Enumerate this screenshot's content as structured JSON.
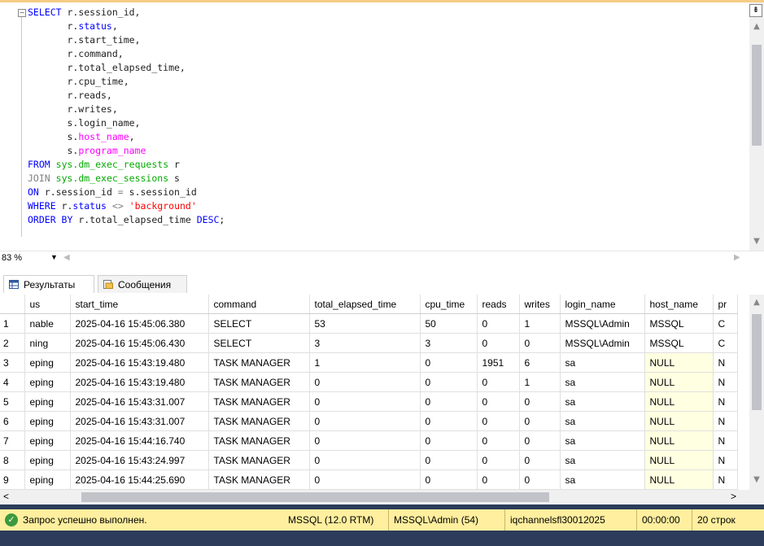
{
  "editor": {
    "lines": [
      [
        {
          "t": "SELECT",
          "c": "kw"
        },
        {
          "t": " r.session_id,",
          "c": ""
        }
      ],
      [
        {
          "t": "       r.",
          "c": ""
        },
        {
          "t": "status",
          "c": "kw"
        },
        {
          "t": ",",
          "c": ""
        }
      ],
      [
        {
          "t": "       r.start_time,",
          "c": ""
        }
      ],
      [
        {
          "t": "       r.command,",
          "c": ""
        }
      ],
      [
        {
          "t": "       r.total_elapsed_time,",
          "c": ""
        }
      ],
      [
        {
          "t": "       r.cpu_time,",
          "c": ""
        }
      ],
      [
        {
          "t": "       r.reads,",
          "c": ""
        }
      ],
      [
        {
          "t": "       r.writes,",
          "c": ""
        }
      ],
      [
        {
          "t": "       s.login_name,",
          "c": ""
        }
      ],
      [
        {
          "t": "       s.",
          "c": ""
        },
        {
          "t": "host_name",
          "c": "pk"
        },
        {
          "t": ",",
          "c": ""
        }
      ],
      [
        {
          "t": "       s.",
          "c": ""
        },
        {
          "t": "program_name",
          "c": "pk"
        }
      ],
      [
        {
          "t": "FROM",
          "c": "kw"
        },
        {
          "t": " ",
          "c": ""
        },
        {
          "t": "sys.dm_exec_requests",
          "c": "fn"
        },
        {
          "t": " r",
          "c": ""
        }
      ],
      [
        {
          "t": "JOIN",
          "c": "op"
        },
        {
          "t": " ",
          "c": ""
        },
        {
          "t": "sys.dm_exec_sessions",
          "c": "fn"
        },
        {
          "t": " s",
          "c": ""
        }
      ],
      [
        {
          "t": "ON",
          "c": "kw"
        },
        {
          "t": " r.session_id ",
          "c": ""
        },
        {
          "t": "=",
          "c": "op"
        },
        {
          "t": " s.session_id",
          "c": ""
        }
      ],
      [
        {
          "t": "WHERE",
          "c": "kw"
        },
        {
          "t": " r.",
          "c": ""
        },
        {
          "t": "status",
          "c": "kw"
        },
        {
          "t": " ",
          "c": ""
        },
        {
          "t": "<>",
          "c": "op"
        },
        {
          "t": " ",
          "c": ""
        },
        {
          "t": "'background'",
          "c": "str"
        }
      ],
      [
        {
          "t": "ORDER BY",
          "c": "kw"
        },
        {
          "t": " r.total_elapsed_time ",
          "c": ""
        },
        {
          "t": "DESC",
          "c": "kw"
        },
        {
          "t": ";",
          "c": ""
        }
      ]
    ]
  },
  "zoom": {
    "value": "83 %"
  },
  "tabs": {
    "results": "Результаты",
    "messages": "Сообщения"
  },
  "grid": {
    "columns": [
      "",
      "us",
      "start_time",
      "command",
      "total_elapsed_time",
      "cpu_time",
      "reads",
      "writes",
      "login_name",
      "host_name",
      "pr"
    ],
    "rows": [
      [
        "1",
        "nable",
        "2025-04-16 15:45:06.380",
        "SELECT",
        "53",
        "50",
        "0",
        "1",
        "MSSQL\\Admin",
        "MSSQL",
        "C"
      ],
      [
        "2",
        "ning",
        "2025-04-16 15:45:06.430",
        "SELECT",
        "3",
        "3",
        "0",
        "0",
        "MSSQL\\Admin",
        "MSSQL",
        "C"
      ],
      [
        "3",
        "eping",
        "2025-04-16 15:43:19.480",
        "TASK MANAGER",
        "1",
        "0",
        "1951",
        "6",
        "sa",
        "NULL",
        "N"
      ],
      [
        "4",
        "eping",
        "2025-04-16 15:43:19.480",
        "TASK MANAGER",
        "0",
        "0",
        "0",
        "1",
        "sa",
        "NULL",
        "N"
      ],
      [
        "5",
        "eping",
        "2025-04-16 15:43:31.007",
        "TASK MANAGER",
        "0",
        "0",
        "0",
        "0",
        "sa",
        "NULL",
        "N"
      ],
      [
        "6",
        "eping",
        "2025-04-16 15:43:31.007",
        "TASK MANAGER",
        "0",
        "0",
        "0",
        "0",
        "sa",
        "NULL",
        "N"
      ],
      [
        "7",
        "eping",
        "2025-04-16 15:44:16.740",
        "TASK MANAGER",
        "0",
        "0",
        "0",
        "0",
        "sa",
        "NULL",
        "N"
      ],
      [
        "8",
        "eping",
        "2025-04-16 15:43:24.997",
        "TASK MANAGER",
        "0",
        "0",
        "0",
        "0",
        "sa",
        "NULL",
        "N"
      ],
      [
        "9",
        "eping",
        "2025-04-16 15:44:25.690",
        "TASK MANAGER",
        "0",
        "0",
        "0",
        "0",
        "sa",
        "NULL",
        "N"
      ]
    ]
  },
  "status": {
    "message": "Запрос успешно выполнен.",
    "server": "MSSQL (12.0 RTM)",
    "user": "MSSQL\\Admin (54)",
    "database": "iqchannelsfl30012025",
    "time": "00:00:00",
    "rows": "20 строк"
  },
  "colors": {
    "status_bg": "#ffef9e",
    "keyword": "#0000ff",
    "function": "#00aa00",
    "pink": "#ff00ff",
    "string": "#ff0000",
    "null_bg": "#ffffe1"
  }
}
